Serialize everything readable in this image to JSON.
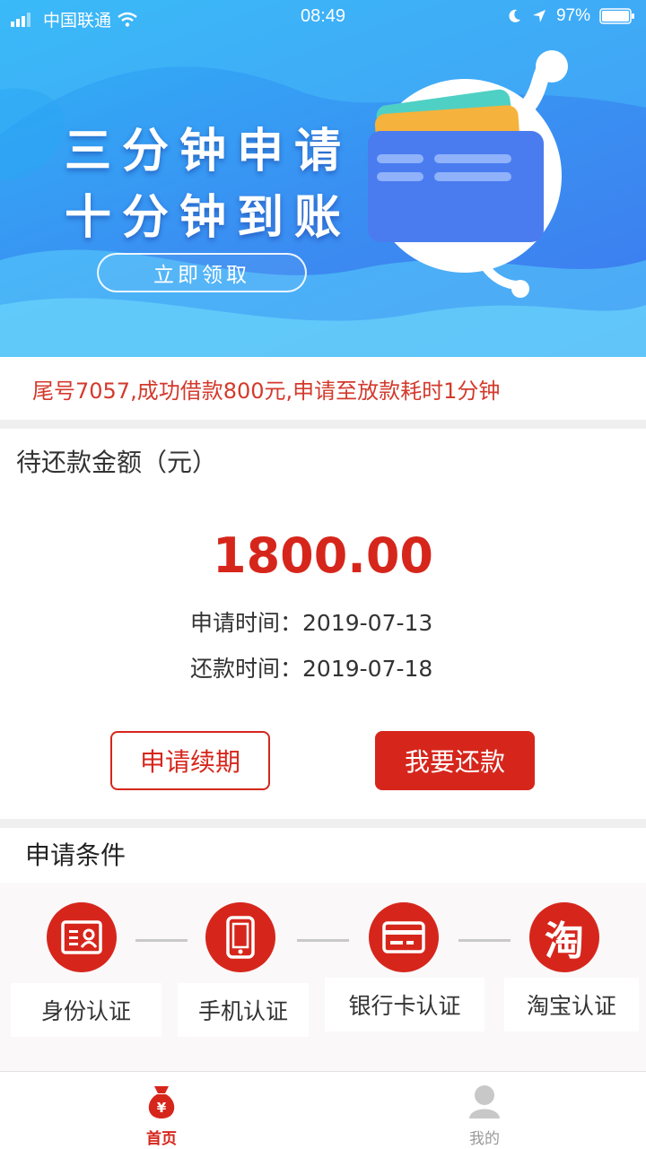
{
  "status_bar": {
    "carrier": "中国联通",
    "time": "08:49",
    "battery": "97%"
  },
  "banner": {
    "line1": "三分钟申请",
    "line2": "十分钟到账",
    "button_label": "立即领取"
  },
  "notice": {
    "text": "尾号7057,成功借款800元,申请至放款耗时1分钟"
  },
  "repayment": {
    "title": "待还款金额（元）",
    "amount": "1800.00",
    "apply_label": "申请时间：",
    "apply_date": "2019-07-13",
    "due_label": "还款时间：",
    "due_date": "2019-07-18",
    "renew_label": "申请续期",
    "repay_label": "我要还款"
  },
  "conditions": {
    "title": "申请条件",
    "steps": [
      {
        "label": "身份认证",
        "icon": "id-card-icon"
      },
      {
        "label": "手机认证",
        "icon": "phone-icon"
      },
      {
        "label": "银行卡认证",
        "icon": "bank-card-icon"
      },
      {
        "label": "淘宝认证",
        "icon": "taobao-icon",
        "glyph": "淘"
      }
    ]
  },
  "tabs": [
    {
      "label": "首页",
      "icon": "money-bag-icon",
      "active": true
    },
    {
      "label": "我的",
      "icon": "user-icon",
      "active": false
    }
  ],
  "colors": {
    "accent": "#d6261c",
    "banner_start": "#2fb4f6",
    "banner_end": "#3e78ee"
  }
}
